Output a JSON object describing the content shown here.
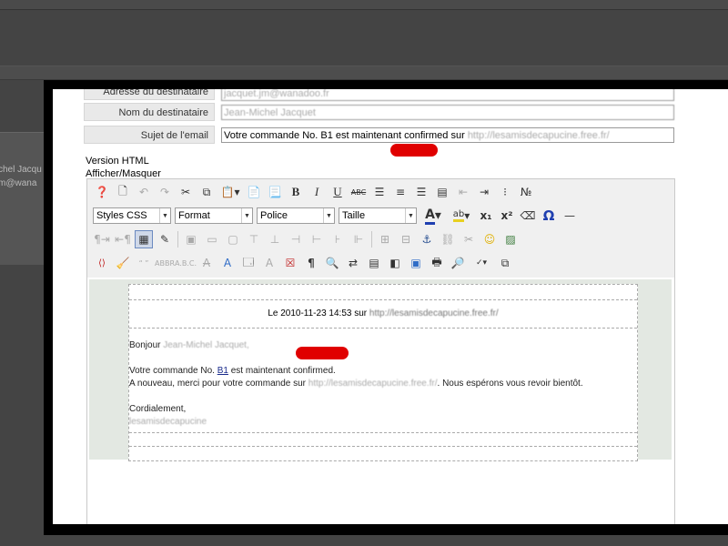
{
  "background": {
    "partial_name": "chel Jacqu",
    "partial_email": "m@wana"
  },
  "form": {
    "recipient_address_label": "Adresse du destinataire",
    "recipient_address_value": "jacquet.jm@wanadoo.fr",
    "recipient_name_label": "Nom du destinataire",
    "recipient_name_value": "Jean-Michel Jacquet",
    "subject_label": "Sujet de l'email",
    "subject_prefix": "Votre commande No. B1 est maintenant confirmed sur",
    "subject_url": "http://lesamisdecapucine.free.fr/"
  },
  "view_links": {
    "html_version": "Version HTML",
    "show_hide": "Afficher/Masquer"
  },
  "toolbar": {
    "styles_label": "Styles CSS",
    "format_label": "Format",
    "font_label": "Police",
    "size_label": "Taille"
  },
  "message": {
    "header_prefix": "Le 2010-11-23 14:53 sur",
    "header_url": "http://lesamisdecapucine.free.fr/",
    "greeting": "Bonjour",
    "greeting_name": "Jean-Michel Jacquet,",
    "line1_prefix": "Votre commande No.",
    "order_link": "B1",
    "line1_suffix": "est maintenant confirmed.",
    "line2_prefix": "A nouveau, merci pour votre commande sur",
    "line2_url": "http://lesamisdecapucine.free.fr/",
    "line2_suffix": ". Nous espérons vous revoir bientôt.",
    "closing": "Cordialement,",
    "signature": "lesamisdecapucine"
  },
  "colors": {
    "annotation": "#e00000",
    "link": "#1a2b8c",
    "editor_bg": "#e3e8e2"
  }
}
